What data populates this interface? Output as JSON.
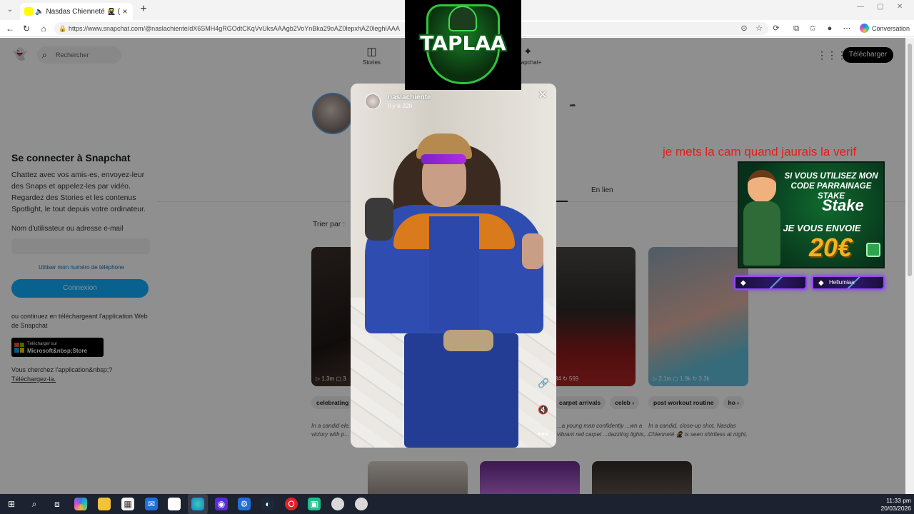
{
  "browser": {
    "tab_title": "Nasdas Chienneté 🥷 (@nasl",
    "url": "https://www.snapchat.com/@naslachiente/dX6SMH4gRGOdtCKqVvUksAAAgb2VoYnBka29oAZ0lepxhAZ0leghIAAA",
    "copilot_label": "Conversation"
  },
  "header": {
    "search_placeholder": "Rechercher",
    "nav": [
      {
        "label": "Stories",
        "icon": "stories-icon"
      },
      {
        "label": "Sp",
        "icon": "spotlight-icon"
      },
      {
        "label": "Snapchat+",
        "icon": "snapchat-plus-icon"
      }
    ],
    "download_label": "Télécharger"
  },
  "login": {
    "title": "Se connecter à Snapchat",
    "description": "Chattez avec vos amis·es, envoyez-leur des Snaps et appelez-les par vidéo. Regardez des Stories et les contenus Spotlight, le tout depuis votre ordinateur.",
    "username_label": "Nom d'utilisateur ou adresse e-mail",
    "phone_link": "Utiliser mon numéro de téléphone",
    "connect_button": "Connexion",
    "alt_text": "ou continuez en téléchargeant l'application Web de Snapchat",
    "store_small": "Télécharger sur",
    "store_big": "Microsoft&nbsp;Store",
    "lookfor_text": "Vous cherchez l'application&nbsp;?",
    "lookfor_link": "Téléchargez-la."
  },
  "profile": {
    "tab_link": "En lien",
    "sort_label": "Trier par :"
  },
  "cards": [
    {
      "stats": "▷ 1.3m  ▢ 3"
    },
    {
      "stats": "▷ 634  ↻ 569"
    },
    {
      "stats": "▷ 2.1m  ▢ 1.9k  ↻ 3.3k"
    }
  ],
  "chips": {
    "card1": [
      "celebrating"
    ],
    "card3": [
      "carpet arrivals",
      "celeb ›"
    ],
    "card4": [
      "post workout routine",
      "ho ›"
    ]
  },
  "captions": {
    "card1": "In a candid ele... Nasdas Chien... a victory with p...",
    "card3": "...a young man confidently ...wn a vibrant red carpet ...dazzling lights,...",
    "card4": "In a candid, close-up shot, Nasdas Chienneté 🥷 is seen shirtless at night, wiping his fac..."
  },
  "story": {
    "username": "naslachiente",
    "time": "Il y a 22h"
  },
  "overlays": {
    "channel_logo": "TAPLAA",
    "red_text": "je mets la cam quand jaurais la verif",
    "stake_line1": "SI VOUS UTILISEZ MON",
    "stake_line2": "CODE PARRAINAGE STAKE",
    "stake_logo": "Stake",
    "stake_line3": "JE VOUS ENVOIE",
    "stake_amount": "20€",
    "sub_name": "Hellumiaa"
  },
  "taskbar": {
    "time": "11:33 pm",
    "date": "20/03/2026"
  },
  "colors": {
    "snap_blue": "#0fadff",
    "overlay_red": "#e81b1b",
    "stake_gold": "#f5b21c"
  }
}
